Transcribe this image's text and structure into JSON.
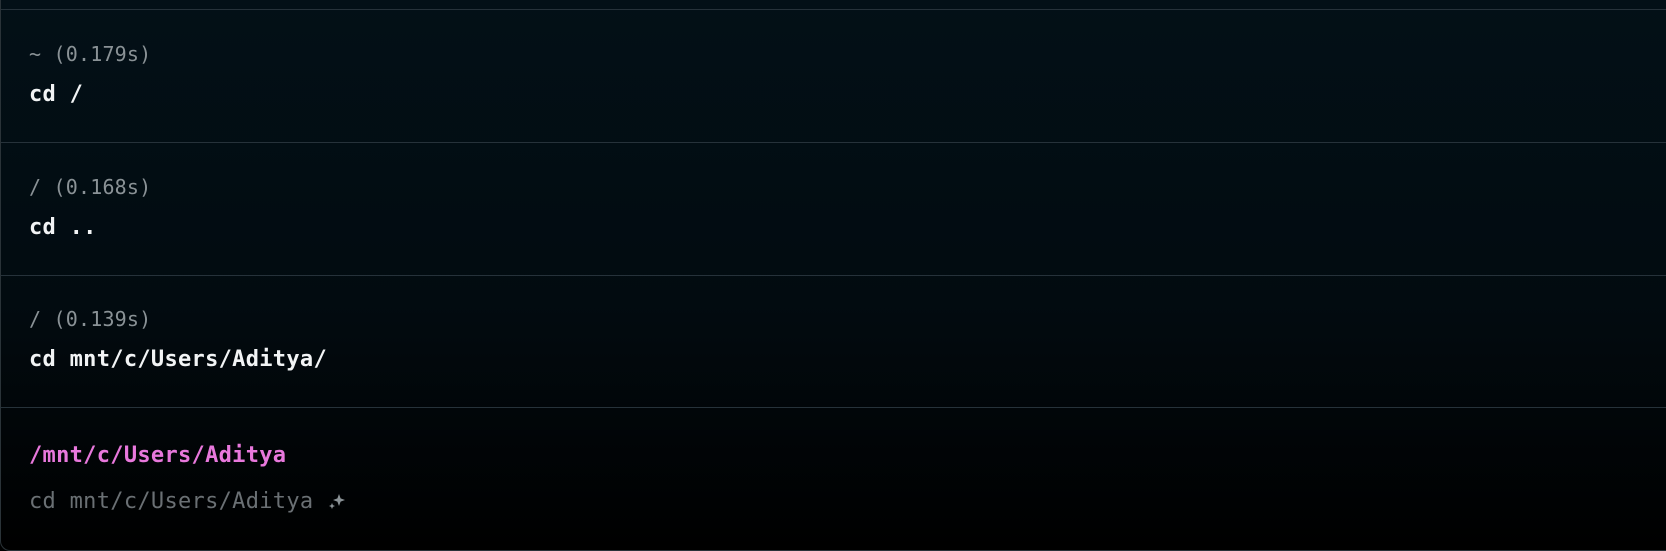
{
  "history": [
    {
      "meta": "~ (0.179s)",
      "command": "cd /"
    },
    {
      "meta": "/ (0.168s)",
      "command": "cd .."
    },
    {
      "meta": "/ (0.139s)",
      "command": "cd mnt/c/Users/Aditya/"
    }
  ],
  "prompt": {
    "cwd": "/mnt/c/Users/Aditya",
    "suggestion": "cd mnt/c/Users/Aditya",
    "suggestion_icon": "sparkle-icon"
  },
  "colors": {
    "background": "#020b10",
    "cwd": "#e878dc",
    "command": "#f2f4f5",
    "meta": "#8a9296",
    "ghost": "#6a7074",
    "divider": "#26323a"
  }
}
